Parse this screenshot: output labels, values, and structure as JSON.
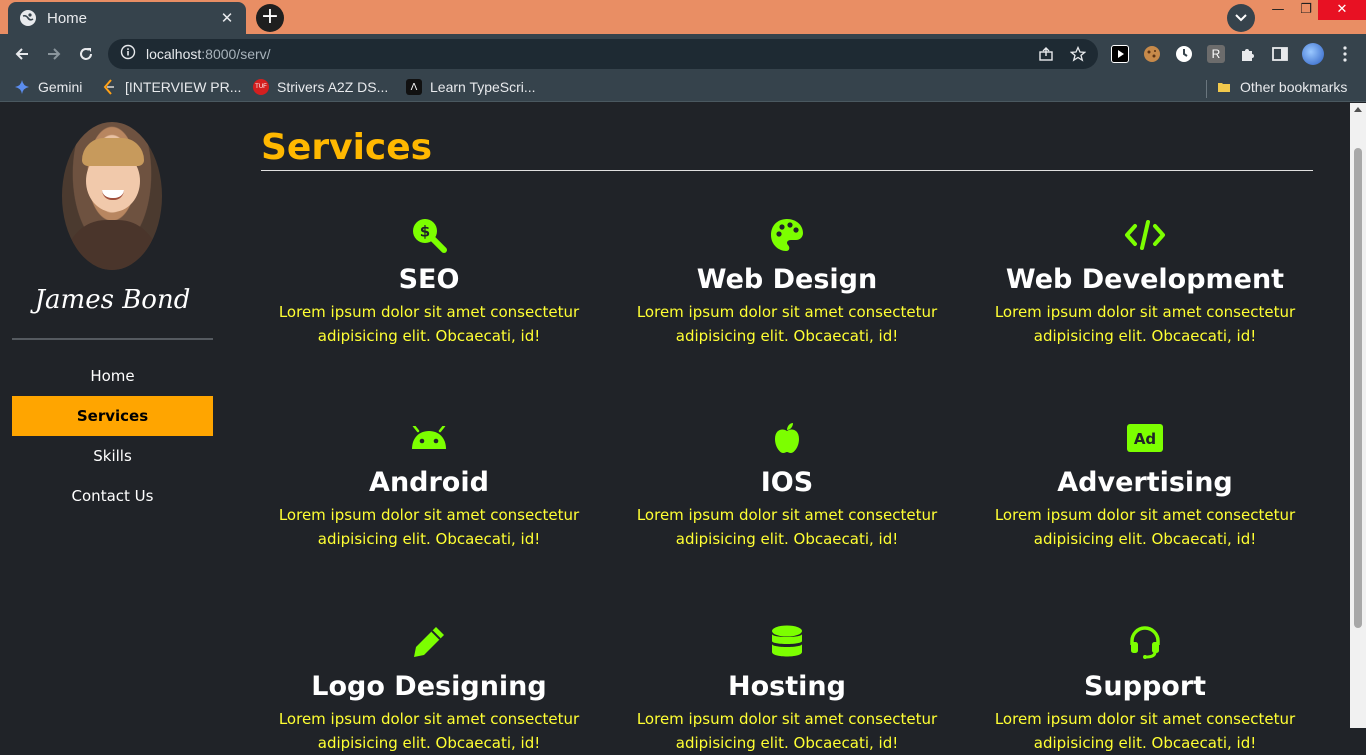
{
  "browser": {
    "tab_title": "Home",
    "tab_close": "✕",
    "new_tab": "+",
    "url_host": "localhost",
    "url_rest": ":8000/serv/",
    "win_min": "—",
    "win_max": "❐",
    "win_close": "✕"
  },
  "bookmarks": {
    "items": [
      {
        "label": "Gemini"
      },
      {
        "label": "[INTERVIEW PR..."
      },
      {
        "label": "Strivers A2Z DS..."
      },
      {
        "label": "Learn TypeScri..."
      }
    ],
    "other": "Other bookmarks"
  },
  "sidebar": {
    "name": "James Bond",
    "nav": [
      {
        "label": "Home"
      },
      {
        "label": "Services"
      },
      {
        "label": "Skills"
      },
      {
        "label": "Contact Us"
      }
    ],
    "active_index": 1
  },
  "main": {
    "title": "Services",
    "services": [
      {
        "title": "SEO",
        "icon": "search-dollar-icon",
        "desc": "Lorem ipsum dolor sit amet consectetur adipisicing elit. Obcaecati, id!"
      },
      {
        "title": "Web Design",
        "icon": "palette-icon",
        "desc": "Lorem ipsum dolor sit amet consectetur adipisicing elit. Obcaecati, id!"
      },
      {
        "title": "Web Development",
        "icon": "code-icon",
        "desc": "Lorem ipsum dolor sit amet consectetur adipisicing elit. Obcaecati, id!"
      },
      {
        "title": "Android",
        "icon": "android-icon",
        "desc": "Lorem ipsum dolor sit amet consectetur adipisicing elit. Obcaecati, id!"
      },
      {
        "title": "IOS",
        "icon": "apple-icon",
        "desc": "Lorem ipsum dolor sit amet consectetur adipisicing elit. Obcaecati, id!"
      },
      {
        "title": "Advertising",
        "icon": "ad-icon",
        "desc": "Lorem ipsum dolor sit amet consectetur adipisicing elit. Obcaecati, id!"
      },
      {
        "title": "Logo Designing",
        "icon": "pencil-icon",
        "desc": "Lorem ipsum dolor sit amet consectetur adipisicing elit. Obcaecati, id!"
      },
      {
        "title": "Hosting",
        "icon": "database-icon",
        "desc": "Lorem ipsum dolor sit amet consectetur adipisicing elit. Obcaecati, id!"
      },
      {
        "title": "Support",
        "icon": "headset-icon",
        "desc": "Lorem ipsum dolor sit amet consectetur adipisicing elit. Obcaecati, id!"
      }
    ]
  },
  "colors": {
    "accent": "#ffa500",
    "title": "#ffb800",
    "icon": "#7cff00",
    "desc": "#ffff33",
    "background": "#202328"
  }
}
